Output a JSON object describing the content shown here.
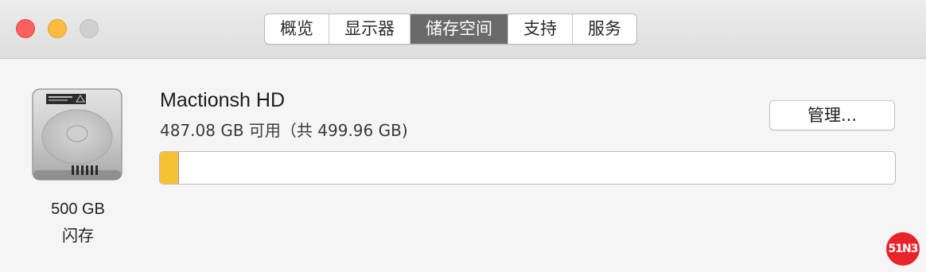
{
  "window": {
    "controls": [
      "close",
      "minimize",
      "zoom"
    ],
    "tabs": [
      {
        "label": "概览",
        "active": false
      },
      {
        "label": "显示器",
        "active": false
      },
      {
        "label": "储存空间",
        "active": true
      },
      {
        "label": "支持",
        "active": false
      },
      {
        "label": "服务",
        "active": false
      }
    ]
  },
  "disk": {
    "icon": "hard-drive-icon",
    "size_label": "500 GB",
    "type_label": "闪存"
  },
  "volume": {
    "name": "Mactionsh HD",
    "capacity_text": "487.08 GB 可用（共 499.96 GB)",
    "used_fraction": 0.0257,
    "used_color": "#f5c233"
  },
  "actions": {
    "manage_label": "管理..."
  },
  "watermark": {
    "text": "51N3"
  }
}
